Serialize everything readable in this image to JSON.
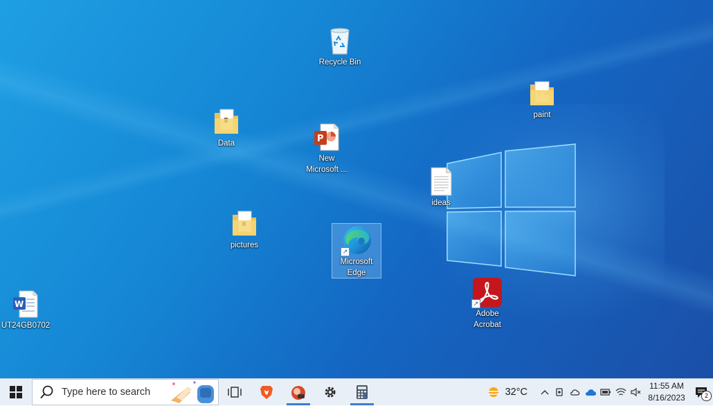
{
  "desktop": {
    "icons": [
      {
        "id": "recycle-bin",
        "label": "Recycle Bin",
        "kind": "recycle-bin-icon"
      },
      {
        "id": "paint",
        "label": "paint",
        "kind": "folder-icon"
      },
      {
        "id": "data",
        "label": "Data",
        "kind": "folder-icon"
      },
      {
        "id": "new-microsoft",
        "label": "New Microsoft ...",
        "kind": "powerpoint-file-icon"
      },
      {
        "id": "ideas",
        "label": "ideas",
        "kind": "text-file-icon"
      },
      {
        "id": "pictures",
        "label": "pictures",
        "kind": "folder-icon"
      },
      {
        "id": "microsoft-edge",
        "label": "Microsoft Edge",
        "kind": "edge-icon",
        "selected": true
      },
      {
        "id": "word-doc",
        "label": "UT24GB0702",
        "kind": "word-file-icon"
      },
      {
        "id": "adobe-acrobat",
        "label": "Adobe Acrobat",
        "kind": "acrobat-icon"
      }
    ]
  },
  "taskbar": {
    "search": {
      "placeholder": "Type here to search"
    },
    "weather": {
      "temp": "32°C"
    },
    "clock": {
      "time": "11:55 AM",
      "date": "8/16/2023"
    },
    "notifications": {
      "count": "2"
    }
  },
  "colors": {
    "accent": "#3c7bd1",
    "taskbar": "#e9eff6"
  }
}
